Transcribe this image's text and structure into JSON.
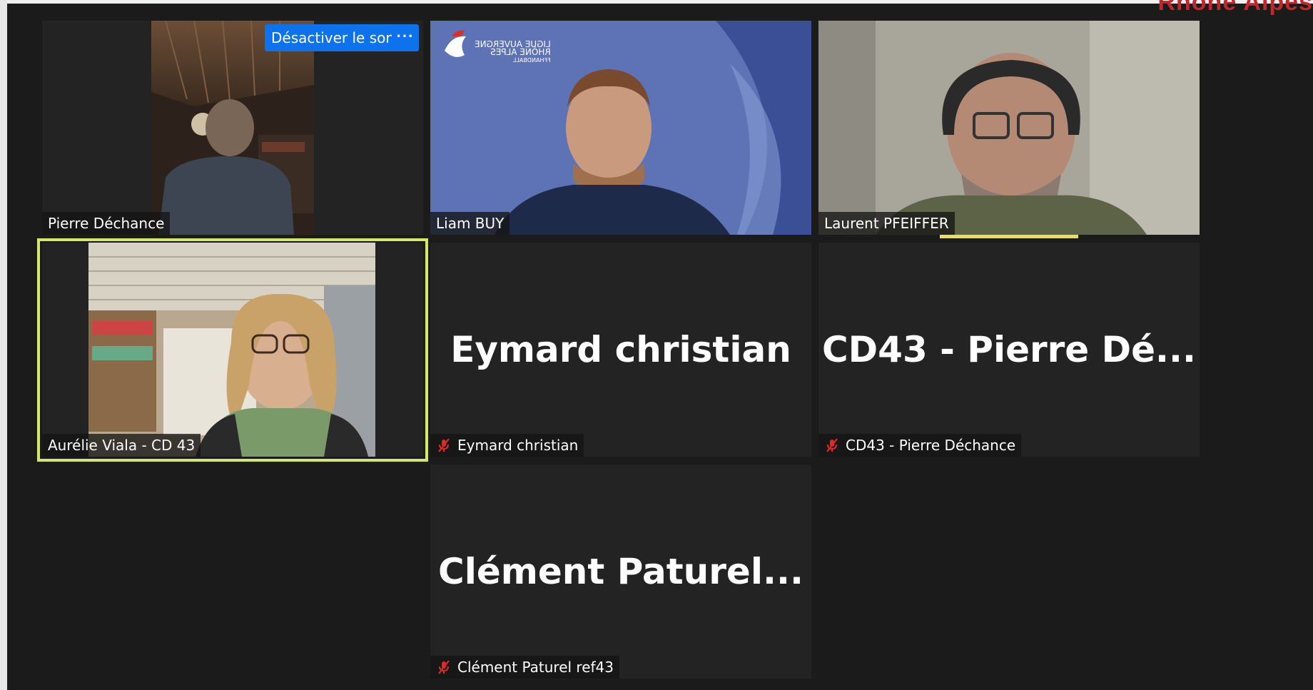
{
  "window": {
    "corner_text": "Rhône Alpes"
  },
  "controls": {
    "unmute_label": "Désactiver le son",
    "more_label": "···"
  },
  "participants": [
    {
      "name": "Pierre Déchance",
      "video_on": true,
      "muted": false
    },
    {
      "name": "Liam BUY",
      "video_on": true,
      "muted": false,
      "background_logo_text": [
        "LIGUE AUVERGNE",
        "RHÔNE ALPES",
        "FFHANDBALL"
      ]
    },
    {
      "name": "Laurent PFEIFFER",
      "video_on": true,
      "muted": false,
      "speaking": true
    },
    {
      "name": "Aurélie Viala - CD 43",
      "video_on": true,
      "muted": false,
      "active": true
    },
    {
      "name": "Eymard christian",
      "display_name": "Eymard christian",
      "video_on": false,
      "muted": true
    },
    {
      "name": "CD43 - Pierre Déchance",
      "display_name": "CD43  - Pierre Dé...",
      "video_on": false,
      "muted": true
    },
    {
      "name": "Clément Paturel ref43",
      "display_name": "Clément  Paturel...",
      "video_on": false,
      "muted": true
    }
  ],
  "colors": {
    "background": "#1b1b1b",
    "tile": "#232323",
    "button_blue": "#0e72ed",
    "active_border": "#d4e86a",
    "mute_red": "#e02828"
  }
}
